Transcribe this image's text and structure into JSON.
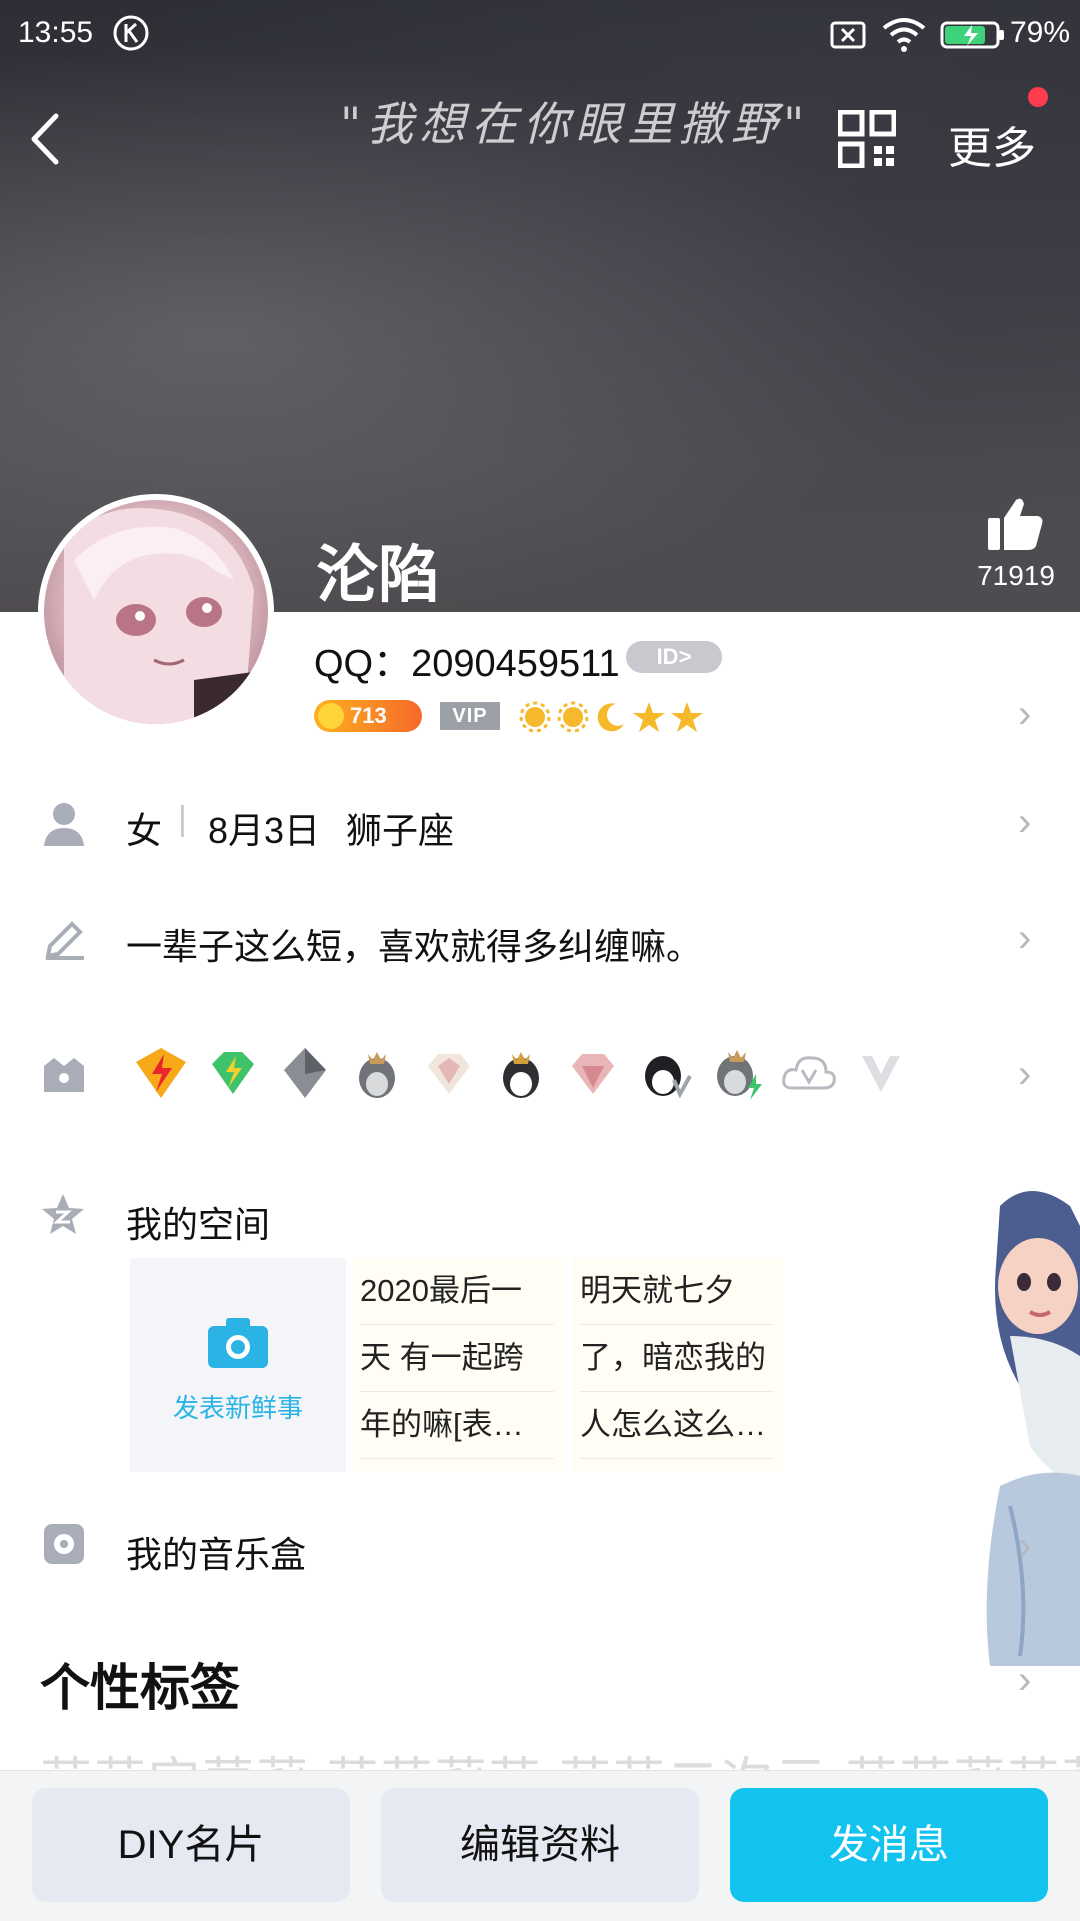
{
  "status_bar": {
    "time": "13:55",
    "battery": "79%"
  },
  "header": {
    "quote": "\"我想在你眼里撒野\"",
    "more_label": "更多",
    "nickname": "沦陷",
    "like_count": "71919"
  },
  "profile": {
    "qq_label": "QQ：2090459511",
    "id_badge": "ID>",
    "coin_value": "713",
    "vip_label": "VIP"
  },
  "info": {
    "gender": "女",
    "birthday": "8月3日",
    "zodiac": "狮子座",
    "signature": "一辈子这么短，喜欢就得多纠缠嘛。"
  },
  "badges": {
    "items": [
      "lv1-lightning-badge-icon",
      "lv1-diamond-badge-icon",
      "grey-diamond-badge-icon",
      "penguin-crown-icon",
      "pink-diamond-icon",
      "penguin-king-icon",
      "rose-diamond-icon",
      "penguin-v-icon",
      "penguin-lightning-icon",
      "cloud-v-icon",
      "v-badge-icon"
    ]
  },
  "zone": {
    "title": "我的空间",
    "new_post_label": "发表新鲜事",
    "posts": [
      {
        "lines": [
          "2020最后一",
          "天 有一起跨",
          "年的嘛[表…"
        ]
      },
      {
        "lines": [
          "明天就七夕",
          "了，暗恋我的",
          "人怎么这么…"
        ]
      }
    ]
  },
  "music": {
    "title": "我的音乐盒"
  },
  "tags": {
    "title": "个性标签",
    "preview": "萌萌宝萝莉 萌萌莉萌 萌萌二次元 萌萌莉萌莉"
  },
  "bottom": {
    "diy_label": "DIY名片",
    "edit_label": "编辑资料",
    "message_label": "发消息"
  },
  "colors": {
    "accent": "#12c3f0",
    "red_dot": "#ff3b4e",
    "zone_link": "#2bb3e6"
  }
}
